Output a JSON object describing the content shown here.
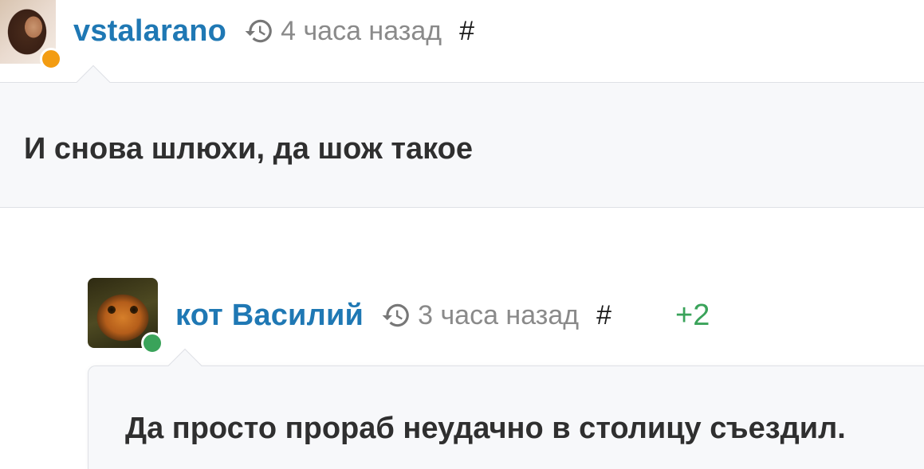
{
  "colors": {
    "author_link": "#1f78b4",
    "timestamp": "#8a8a8a",
    "score_positive": "#3aa35a",
    "status_away": "#f39c12",
    "status_online": "#3aa35a",
    "bubble_background": "#f7f8fa"
  },
  "comments": [
    {
      "author": "vstalarano",
      "avatar_icon": "user-avatar-photo",
      "status": "away",
      "time_icon": "history-icon",
      "time": "4 часа назад",
      "permalink": "#",
      "score": "",
      "text": "И снова шлюхи, да шож такое"
    },
    {
      "author": "кот Василий",
      "avatar_icon": "cat-avatar-photo",
      "status": "online",
      "time_icon": "history-icon",
      "time": "3 часа назад",
      "permalink": "#",
      "score": "+2",
      "text": "Да просто прораб неудачно в столицу съездил."
    }
  ]
}
